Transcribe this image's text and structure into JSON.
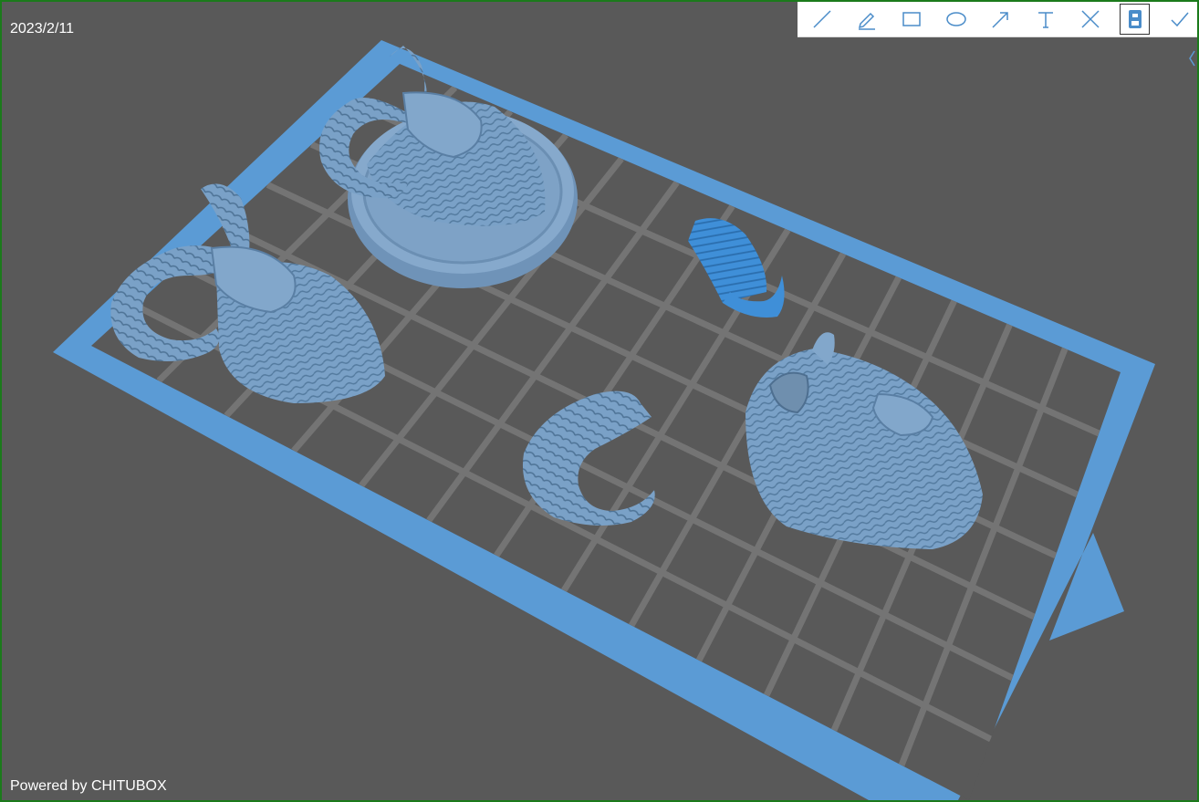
{
  "date": "2023/2/11",
  "powered_by": "Powered by CHITUBOX",
  "colors": {
    "accent": "#5b9bd5",
    "background": "#595959",
    "frame_border": "#1b7a1b",
    "plate_grid": "#727272",
    "model": "#7aa1c7",
    "model_selected": "#3f8fd8"
  },
  "toolbar": {
    "tools": [
      {
        "name": "line-tool",
        "icon": "line-icon"
      },
      {
        "name": "pen-tool",
        "icon": "pencil-icon"
      },
      {
        "name": "rectangle-tool",
        "icon": "rectangle-icon"
      },
      {
        "name": "ellipse-tool",
        "icon": "ellipse-icon"
      },
      {
        "name": "arrow-tool",
        "icon": "arrow-icon"
      },
      {
        "name": "text-tool",
        "icon": "text-icon"
      },
      {
        "name": "cancel-tool",
        "icon": "close-icon"
      },
      {
        "name": "save-tool",
        "icon": "save-icon",
        "active": true
      },
      {
        "name": "confirm-tool",
        "icon": "check-icon"
      }
    ]
  },
  "scene": {
    "models": [
      {
        "name": "ram-head-with-horn-left",
        "selected": false
      },
      {
        "name": "ram-head-on-round-base",
        "selected": false
      },
      {
        "name": "curled-horn-small",
        "selected": true
      },
      {
        "name": "curled-horn-large",
        "selected": false
      },
      {
        "name": "ram-head-no-horn",
        "selected": false
      }
    ]
  }
}
